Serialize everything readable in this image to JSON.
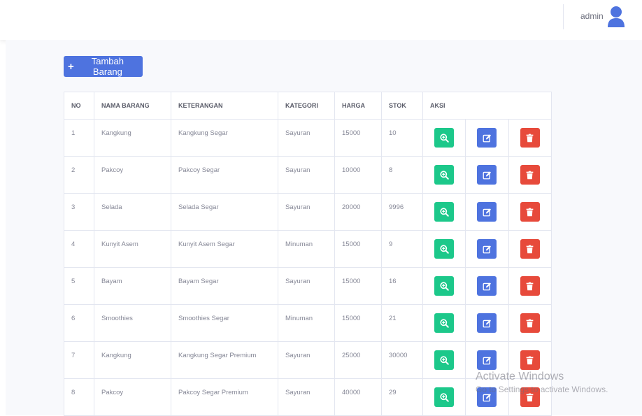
{
  "topbar": {
    "username": "admin"
  },
  "toolbar": {
    "add_label": "Tambah Barang"
  },
  "table": {
    "headers": [
      "NO",
      "NAMA BARANG",
      "KETERANGAN",
      "KATEGORI",
      "HARGA",
      "STOK",
      "AKSI"
    ],
    "rows": [
      [
        "1",
        "Kangkung",
        "Kangkung Segar",
        "Sayuran",
        "15000",
        "10"
      ],
      [
        "2",
        "Pakcoy",
        "Pakcoy Segar",
        "Sayuran",
        "10000",
        "8"
      ],
      [
        "3",
        "Selada",
        "Selada Segar",
        "Sayuran",
        "20000",
        "9996"
      ],
      [
        "4",
        "Kunyit Asem",
        "Kunyit Asem Segar",
        "Minuman",
        "15000",
        "9"
      ],
      [
        "5",
        "Bayam",
        "Bayam Segar",
        "Sayuran",
        "15000",
        "16"
      ],
      [
        "6",
        "Smoothies",
        "Smoothies Segar",
        "Minuman",
        "15000",
        "21"
      ],
      [
        "7",
        "Kangkung",
        "Kangkung Segar Premium",
        "Sayuran",
        "25000",
        "30000"
      ],
      [
        "8",
        "Pakcoy",
        "Pakcoy Segar Premium",
        "Sayuran",
        "40000",
        "29"
      ]
    ]
  },
  "watermark": {
    "title": "Activate Windows",
    "subtitle": "Go to Settings to activate Windows."
  },
  "colors": {
    "primary": "#4e73df",
    "success": "#1cc88a",
    "danger": "#e74a3b"
  },
  "icons": {
    "view": "search-plus-icon",
    "edit": "edit-icon",
    "delete": "trash-icon",
    "avatar": "user-icon",
    "add": "plus-icon"
  }
}
